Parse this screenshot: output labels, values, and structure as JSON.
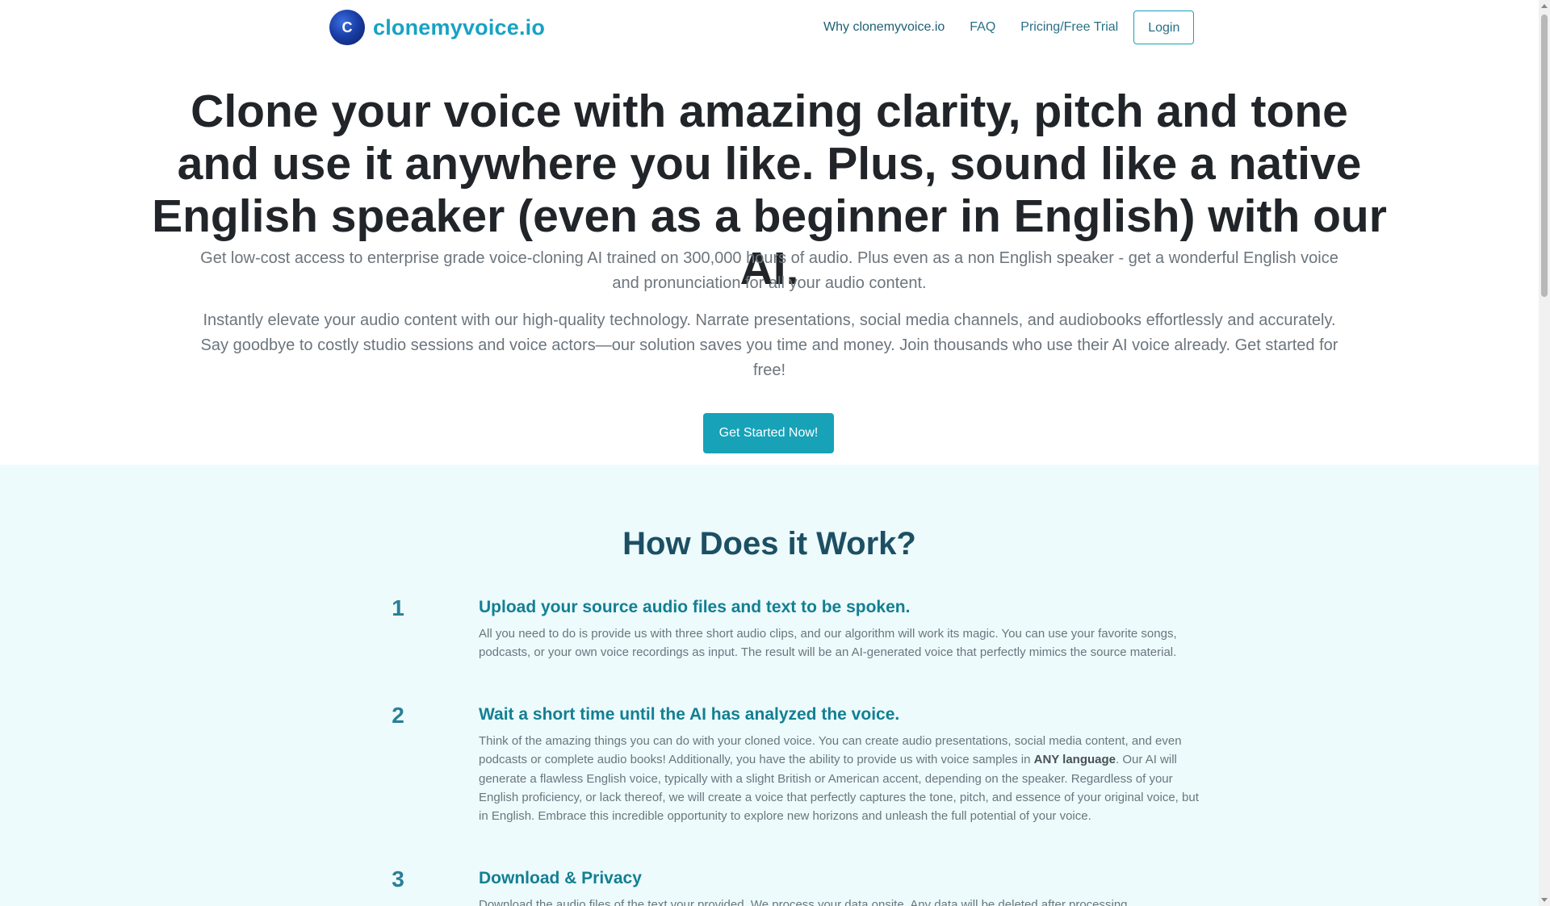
{
  "brand": {
    "logo_letter": "C",
    "name": "clonemyvoice.io"
  },
  "nav": {
    "links": [
      "Why clonemyvoice.io",
      "FAQ",
      "Pricing/Free Trial"
    ],
    "login_label": "Login"
  },
  "hero": {
    "headline": "Clone your voice with amazing clarity, pitch and tone and use it anywhere you like. Plus, sound like a native English speaker (even as a beginner in English) with our AI.",
    "subtext_1": "Get low-cost access to enterprise grade voice-cloning AI trained on 300,000 hours of audio. Plus even as a non English speaker - get a wonderful English voice and pronunciation for all your audio content.",
    "subtext_2": "Instantly elevate your audio content with our high-quality technology. Narrate presentations, social media channels, and audiobooks effortlessly and accurately. Say goodbye to costly studio sessions and voice actors—our solution saves you time and money. Join thousands who use their AI voice already. Get started for free!",
    "cta_label": "Get Started Now!"
  },
  "how": {
    "title": "How Does it Work?",
    "steps": [
      {
        "number": "1",
        "title": "Upload your source audio files and text to be spoken.",
        "desc": "All you need to do is provide us with three short audio clips, and our algorithm will work its magic. You can use your favorite songs, podcasts, or your own voice recordings as input. The result will be an AI-generated voice that perfectly mimics the source material."
      },
      {
        "number": "2",
        "title": "Wait a short time until the AI has analyzed the voice.",
        "desc_before": "Think of the amazing things you can do with your cloned voice. You can create audio presentations, social media content, and even podcasts or complete audio books! Additionally, you have the ability to provide us with voice samples in ",
        "desc_bold": "ANY language",
        "desc_after": ". Our AI will generate a flawless English voice, typically with a slight British or American accent, depending on the speaker. Regardless of your English proficiency, or lack thereof, we will create a voice that perfectly captures the tone, pitch, and essence of your original voice, but in English. Embrace this incredible opportunity to explore new horizons and unleash the full potential of your voice."
      },
      {
        "number": "3",
        "title": "Download & Privacy",
        "desc": "Download the audio files of the text your provided. We process your data onsite. Any data will be deleted after processing."
      }
    ]
  },
  "colors": {
    "accent": "#17a2b8",
    "brand_text": "#17a2c4",
    "section_bg": "#edfbfd",
    "heading_dark": "#1c4f63",
    "step_title": "#137f92"
  }
}
